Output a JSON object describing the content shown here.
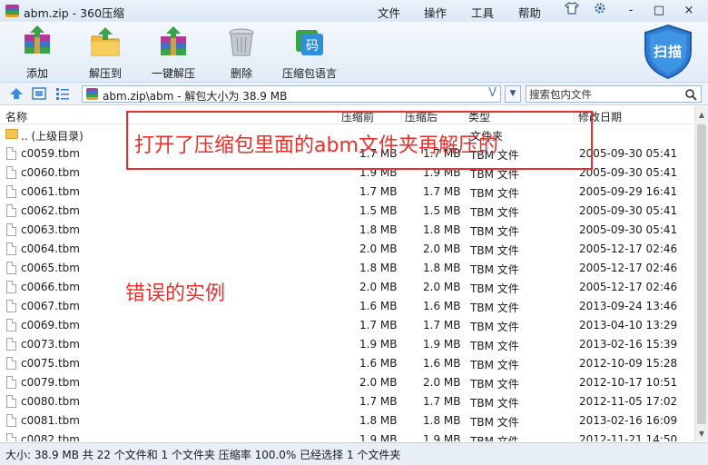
{
  "window": {
    "title": "abm.zip - 360压缩",
    "menu": [
      "文件",
      "操作",
      "工具",
      "帮助"
    ],
    "controls": [
      "-",
      "□",
      "×"
    ]
  },
  "toolbar": {
    "buttons": [
      {
        "label": "添加",
        "icon": "add-books-icon"
      },
      {
        "label": "解压到",
        "icon": "extract-to-folder-icon"
      },
      {
        "label": "一键解压",
        "icon": "one-click-extract-icon"
      },
      {
        "label": "删除",
        "icon": "trash-bin-icon"
      },
      {
        "label": "压缩包语言",
        "icon": "archive-language-icon"
      }
    ],
    "language_icon_text": "码",
    "scan_label": "扫描"
  },
  "address": {
    "path": "abm.zip\\abm - 解包大小为 38.9 MB",
    "search_placeholder": "搜索包内文件"
  },
  "columns": {
    "name": "名称",
    "size": "压缩前",
    "packed": "压缩后",
    "type": "类型",
    "date": "修改日期"
  },
  "files": [
    {
      "name": ".. (上级目录)",
      "size": "",
      "packed": "",
      "type": "文件夹",
      "date": "",
      "is_parent": true
    },
    {
      "name": "c0059.tbm",
      "size": "1.7 MB",
      "packed": "1.7 MB",
      "type": "TBM 文件",
      "date": "2005-09-30 05:41"
    },
    {
      "name": "c0060.tbm",
      "size": "1.9 MB",
      "packed": "1.9 MB",
      "type": "TBM 文件",
      "date": "2005-09-30 05:41"
    },
    {
      "name": "c0061.tbm",
      "size": "1.7 MB",
      "packed": "1.7 MB",
      "type": "TBM 文件",
      "date": "2005-09-29 16:41"
    },
    {
      "name": "c0062.tbm",
      "size": "1.5 MB",
      "packed": "1.5 MB",
      "type": "TBM 文件",
      "date": "2005-09-30 05:41"
    },
    {
      "name": "c0063.tbm",
      "size": "1.8 MB",
      "packed": "1.8 MB",
      "type": "TBM 文件",
      "date": "2005-09-30 05:41"
    },
    {
      "name": "c0064.tbm",
      "size": "2.0 MB",
      "packed": "2.0 MB",
      "type": "TBM 文件",
      "date": "2005-12-17 02:46"
    },
    {
      "name": "c0065.tbm",
      "size": "1.8 MB",
      "packed": "1.8 MB",
      "type": "TBM 文件",
      "date": "2005-12-17 02:46"
    },
    {
      "name": "c0066.tbm",
      "size": "2.0 MB",
      "packed": "2.0 MB",
      "type": "TBM 文件",
      "date": "2005-12-17 02:46"
    },
    {
      "name": "c0067.tbm",
      "size": "1.6 MB",
      "packed": "1.6 MB",
      "type": "TBM 文件",
      "date": "2013-09-24 13:46"
    },
    {
      "name": "c0069.tbm",
      "size": "1.7 MB",
      "packed": "1.7 MB",
      "type": "TBM 文件",
      "date": "2013-04-10 13:29"
    },
    {
      "name": "c0073.tbm",
      "size": "1.9 MB",
      "packed": "1.9 MB",
      "type": "TBM 文件",
      "date": "2013-02-16 15:39"
    },
    {
      "name": "c0075.tbm",
      "size": "1.6 MB",
      "packed": "1.6 MB",
      "type": "TBM 文件",
      "date": "2012-10-09 15:28"
    },
    {
      "name": "c0079.tbm",
      "size": "2.0 MB",
      "packed": "2.0 MB",
      "type": "TBM 文件",
      "date": "2012-10-17 10:51"
    },
    {
      "name": "c0080.tbm",
      "size": "1.7 MB",
      "packed": "1.7 MB",
      "type": "TBM 文件",
      "date": "2012-11-05 17:02"
    },
    {
      "name": "c0081.tbm",
      "size": "1.8 MB",
      "packed": "1.8 MB",
      "type": "TBM 文件",
      "date": "2013-02-16 16:09"
    },
    {
      "name": "c0082.tbm",
      "size": "1.9 MB",
      "packed": "1.9 MB",
      "type": "TBM 文件",
      "date": "2012-11-21 14:50"
    }
  ],
  "status": "大小: 38.9 MB 共 22 个文件和 1 个文件夹 压缩率 100.0% 已经选择 1 个文件夹",
  "annotations": {
    "top_note": "打开了压缩包里面的abm文件夹再解压的",
    "middle_note": "错误的实例",
    "color": "#e8302a"
  }
}
